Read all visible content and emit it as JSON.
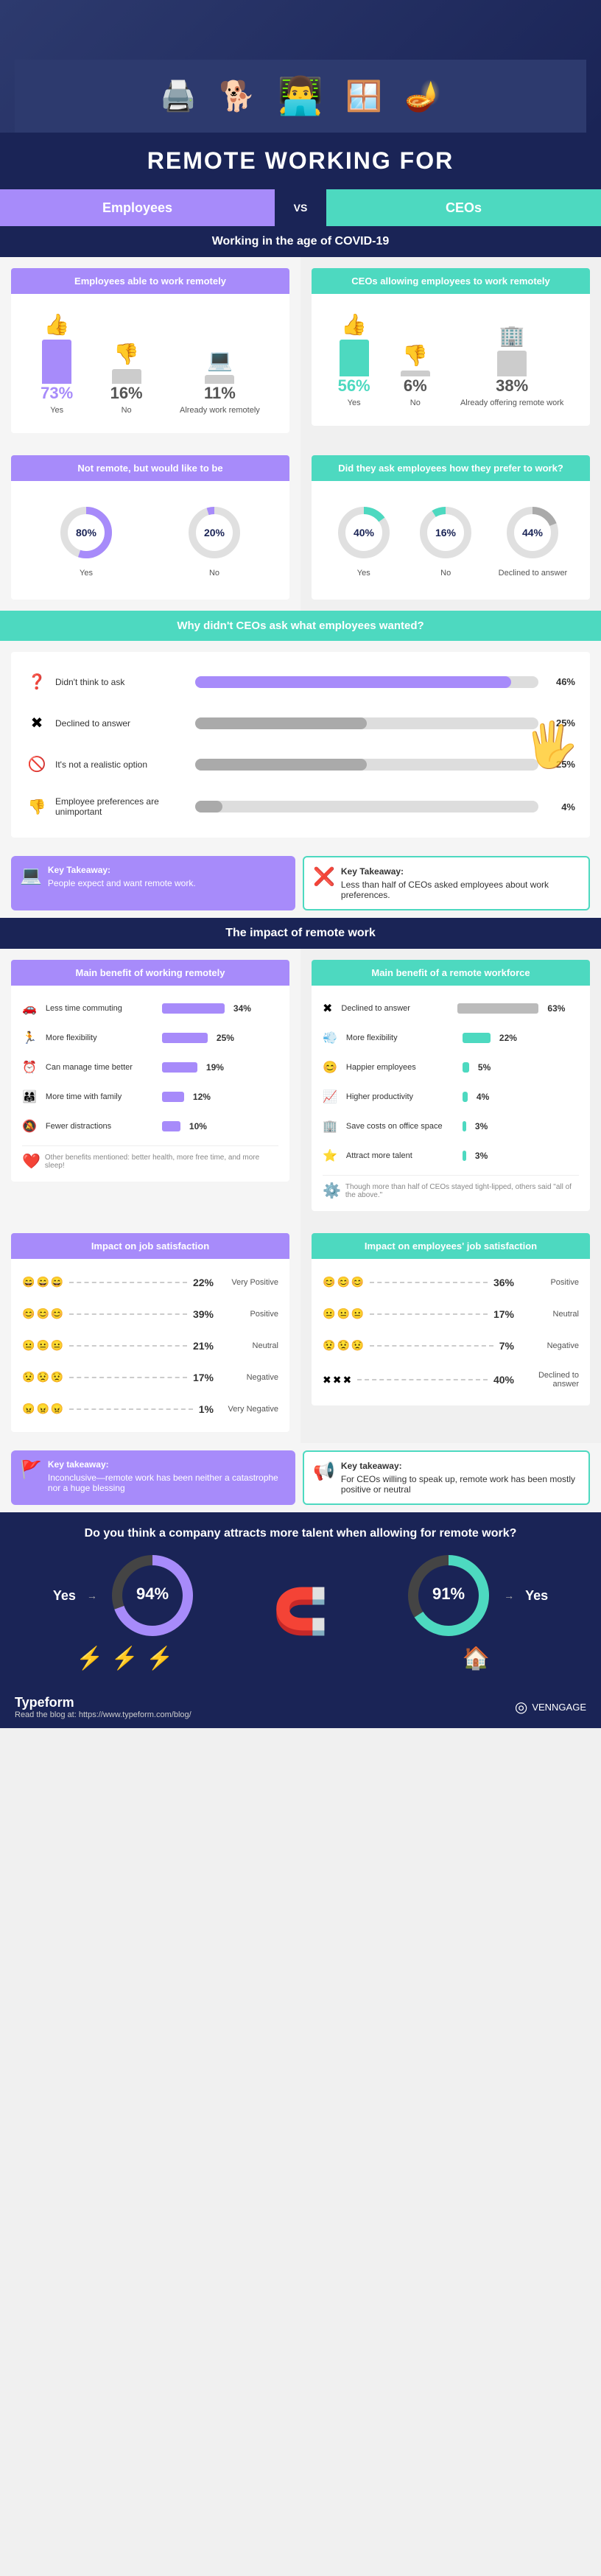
{
  "title": "REMOTE WORKING FOR",
  "subtitle_employees": "Employees",
  "subtitle_vs": "VS",
  "subtitle_ceos": "CEOs",
  "section1_header": "Working in the age of COVID-19",
  "employees_header": "Employees able to work remotely",
  "ceos_header": "CEOs allowing employees to work remotely",
  "emp_yes_pct": "73%",
  "emp_no_pct": "16%",
  "emp_already_pct": "11%",
  "emp_yes_label": "Yes",
  "emp_no_label": "No",
  "emp_already_label": "Already work remotely",
  "ceo_yes_pct": "56%",
  "ceo_no_pct": "6%",
  "ceo_already_pct": "38%",
  "ceo_yes_label": "Yes",
  "ceo_no_label": "No",
  "ceo_already_label": "Already offering remote work",
  "not_remote_header": "Not remote, but would like to be",
  "ask_header": "Did they ask employees how they prefer to work?",
  "not_remote_yes": "80%",
  "not_remote_no": "20%",
  "ask_yes": "40%",
  "ask_no": "16%",
  "ask_declined": "44%",
  "ask_yes_label": "Yes",
  "ask_no_label": "No",
  "ask_declined_label": "Declined to answer",
  "why_header": "Why didn't CEOs ask what employees wanted?",
  "why_rows": [
    {
      "label": "Didn't think to ask",
      "pct": 46,
      "pct_label": "46%",
      "icon": "❓",
      "color": "purple"
    },
    {
      "label": "Declined to answer",
      "pct": 25,
      "pct_label": "25%",
      "icon": "✖",
      "color": "gray"
    },
    {
      "label": "It's not a realistic option",
      "pct": 25,
      "pct_label": "25%",
      "icon": "🚫",
      "color": "gray"
    },
    {
      "label": "Employee preferences are unimportant",
      "pct": 4,
      "pct_label": "4%",
      "icon": "👎",
      "color": "gray"
    }
  ],
  "takeaway1_title": "Key Takeaway:",
  "takeaway1_text": "People expect and want remote work.",
  "takeaway2_title": "Key Takeaway:",
  "takeaway2_text": "Less than half of CEOs asked employees about work preferences.",
  "impact_header": "The impact of remote work",
  "main_benefit_employee_header": "Main benefit of working remotely",
  "main_benefit_ceo_header": "Main benefit of a remote workforce",
  "employee_benefits": [
    {
      "label": "Less time commuting",
      "pct": 34,
      "pct_label": "34%",
      "icon": "🚗"
    },
    {
      "label": "More flexibility",
      "pct": 25,
      "pct_label": "25%",
      "icon": "🏃"
    },
    {
      "label": "Can manage time better",
      "pct": 19,
      "pct_label": "19%",
      "icon": "⏰"
    },
    {
      "label": "More time with family",
      "pct": 12,
      "pct_label": "12%",
      "icon": "👨‍👩‍👧"
    },
    {
      "label": "Fewer distractions",
      "pct": 10,
      "pct_label": "10%",
      "icon": "🔕"
    }
  ],
  "employee_benefits_note": "Other benefits mentioned: better health, more free time, and more sleep!",
  "ceo_benefits": [
    {
      "label": "Declined to answer",
      "pct": 63,
      "pct_label": "63%",
      "icon": "✖"
    },
    {
      "label": "More flexibility",
      "pct": 22,
      "pct_label": "22%",
      "icon": "💨"
    },
    {
      "label": "Happier employees",
      "pct": 5,
      "pct_label": "5%",
      "icon": "😊"
    },
    {
      "label": "Higher productivity",
      "pct": 4,
      "pct_label": "4%",
      "icon": "📈"
    },
    {
      "label": "Save costs on office space",
      "pct": 3,
      "pct_label": "3%",
      "icon": "🏢"
    },
    {
      "label": "Attract more talent",
      "pct": 3,
      "pct_label": "3%",
      "icon": "⭐"
    }
  ],
  "ceo_benefits_note": "Though more than half of CEOs stayed tight-lipped, others said \"all of the above.\"",
  "job_sat_header": "Impact on job satisfaction",
  "emp_sat_header": "Impact on employees' job satisfaction",
  "emp_satisfaction": [
    {
      "label": "Very Positive",
      "pct": "22%",
      "faces": [
        "😄",
        "😄",
        "😄"
      ],
      "color": "#a78bfa"
    },
    {
      "label": "Positive",
      "pct": "39%",
      "faces": [
        "😊",
        "😊",
        "😊"
      ],
      "color": "#a78bfa"
    },
    {
      "label": "Neutral",
      "pct": "21%",
      "faces": [
        "😐",
        "😐",
        "😐"
      ],
      "color": "#aaa"
    },
    {
      "label": "Negative",
      "pct": "17%",
      "faces": [
        "😟",
        "😟",
        "😟"
      ],
      "color": "#aaa"
    },
    {
      "label": "Very Negative",
      "pct": "1%",
      "faces": [
        "😠",
        "😠",
        "😠"
      ],
      "color": "#aaa"
    }
  ],
  "ceo_satisfaction": [
    {
      "label": "Positive",
      "pct": "36%",
      "faces": [
        "😊",
        "😊",
        "😊"
      ],
      "color": "#4dd9c0"
    },
    {
      "label": "Neutral",
      "pct": "17%",
      "faces": [
        "😐",
        "😐",
        "😐"
      ],
      "color": "#aaa"
    },
    {
      "label": "Negative",
      "pct": "7%",
      "faces": [
        "😟",
        "😟",
        "😟"
      ],
      "color": "#aaa"
    },
    {
      "label": "Declined to answer",
      "pct": "40%",
      "faces": [
        "✖",
        "✖",
        "✖"
      ],
      "color": "#aaa"
    }
  ],
  "takeaway3_title": "Key takeaway:",
  "takeaway3_text": "Inconclusive—remote work has been neither a catastrophe nor a huge blessing",
  "takeaway4_title": "Key takeaway:",
  "takeaway4_text": "For CEOs willing to speak up, remote work has been mostly positive or neutral",
  "talent_question": "Do you think a company attracts more talent when allowing for remote work?",
  "talent_emp_pct": "94%",
  "talent_ceo_pct": "91%",
  "talent_yes_label": "Yes",
  "footer_brand": "Typeform",
  "footer_url": "Read the blog at: https://www.typeform.com/blog/",
  "footer_venngage": "VENNGAGE",
  "colors": {
    "purple": "#a78bfa",
    "teal": "#4dd9c0",
    "dark": "#1a2456",
    "light_bg": "#f5f5f5"
  }
}
